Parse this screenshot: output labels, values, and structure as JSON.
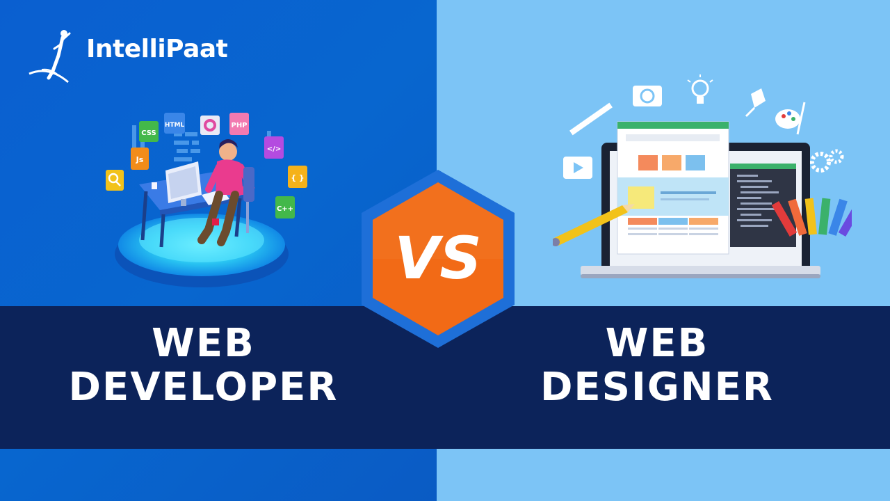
{
  "brand": {
    "name": "IntelliPaat"
  },
  "left": {
    "title_line1": "WEB",
    "title_line2": "DEVELOPER",
    "tech_labels": [
      "CSS",
      "HTML",
      "PHP",
      "</>",
      "Js",
      "{ }",
      "C++"
    ]
  },
  "right": {
    "title_line1": "WEB",
    "title_line2": "DESIGNER"
  },
  "badge": {
    "text": "VS"
  },
  "colors": {
    "left_bg": "#0866cf",
    "right_bg": "#7cc4f6",
    "band": "#0c235a",
    "badge_orange": "#f26a16",
    "badge_border": "#1e6fd8"
  }
}
